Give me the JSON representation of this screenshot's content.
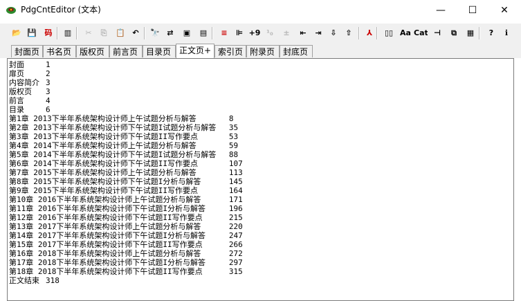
{
  "window": {
    "title": "PdgCntEditor  (文本)",
    "minimize": "—",
    "maximize": "☐",
    "close": "✕"
  },
  "toolbar": {
    "buttons": [
      {
        "icon": "open-folder-icon",
        "glyph": "📂"
      },
      {
        "icon": "save-icon",
        "glyph": "💾"
      },
      {
        "icon": "encoding-icon",
        "glyph": "码",
        "color": "#cc0000"
      },
      {
        "icon": "toggle-view-icon",
        "glyph": "▥"
      },
      {
        "icon": "cut-icon",
        "glyph": "✂",
        "disabled": true
      },
      {
        "icon": "copy-icon",
        "glyph": "⎘",
        "disabled": true
      },
      {
        "icon": "paste-icon",
        "glyph": "📋"
      },
      {
        "icon": "undo-icon",
        "glyph": "↶"
      },
      {
        "icon": "find-icon",
        "glyph": "🔭"
      },
      {
        "icon": "replace-icon",
        "glyph": "⇄"
      },
      {
        "icon": "insert-page-icon",
        "glyph": "▣"
      },
      {
        "icon": "page-properties-icon",
        "glyph": "▤"
      },
      {
        "icon": "align-left-icon",
        "glyph": "≡",
        "color": "#cc0000"
      },
      {
        "icon": "align-indent-icon",
        "glyph": "⊫"
      },
      {
        "icon": "add-number-icon",
        "glyph": "+9"
      },
      {
        "icon": "number-format-icon",
        "glyph": "¹₀",
        "disabled": true
      },
      {
        "icon": "plus-minus-icon",
        "glyph": "±",
        "disabled": true
      },
      {
        "icon": "indent-left-icon",
        "glyph": "⇤"
      },
      {
        "icon": "indent-right-icon",
        "glyph": "⇥"
      },
      {
        "icon": "move-down-icon",
        "glyph": "⇩"
      },
      {
        "icon": "move-up-icon",
        "glyph": "⇧"
      },
      {
        "icon": "pdf-icon",
        "glyph": "⅄",
        "color": "#cc0000"
      },
      {
        "icon": "split-icon",
        "glyph": "▯▯"
      },
      {
        "icon": "font-icon",
        "glyph": "Aa"
      },
      {
        "icon": "catalog-icon",
        "glyph": "Cat"
      },
      {
        "icon": "pin-icon",
        "glyph": "⊣"
      },
      {
        "icon": "window-tile-icon",
        "glyph": "⧉"
      },
      {
        "icon": "screen-icon",
        "glyph": "▦"
      },
      {
        "icon": "help-icon",
        "glyph": "?"
      },
      {
        "icon": "about-icon",
        "glyph": "ℹ"
      }
    ]
  },
  "tabs": [
    {
      "label": "封面页"
    },
    {
      "label": "书名页"
    },
    {
      "label": "版权页"
    },
    {
      "label": "前言页"
    },
    {
      "label": "目录页"
    },
    {
      "label": "正文页+",
      "active": true
    },
    {
      "label": "索引页"
    },
    {
      "label": "附录页"
    },
    {
      "label": "封底页"
    }
  ],
  "editor": {
    "content": "封面\t1\n扉页\t2\n内容简介\t3\n版权页\t3\n前言\t4\n目录\t6\n第1章 2013下半年系统架构设计师上午试题分析与解答\t8\n第2章 2013下半年系统架构设计师下午试题I试题分析与解答\t35\n第3章 2013下半年系统架构设计师下午试题II写作要点\t53\n第4章 2014下半年系统架构设计师上午试题分析与解答\t59\n第5章 2014下半年系统架构设计师下午试题I试题分析与解答\t88\n第6章 2014下半年系统架构设计师下午试题II写作要点\t107\n第7章 2015下半年系统架构设计师上午试题分析与解答\t113\n第8章 2015下半年系统架构设计师下午试题I分析与解答\t145\n第9章 2015下半年系统架构设计师下午试题II写作要点\t164\n第10章 2016下半年系统架构设计师上午试题分析与解答\t171\n第11章 2016下半年系统架构设计师下午试题I分析与解答\t196\n第12章 2016下半年系统架构设计师下午试题II写作要点\t215\n第13章 2017下半年系统架构设计师上午试题分析与解答\t220\n第14章 2017下半年系统架构设计师下午试题I分析与解答\t247\n第15章 2017下半年系统架构设计师下午试题II写作要点\t266\n第16章 2018下半年系统架构设计师上午试题分析与解答\t272\n第17章 2018下半年系统架构设计师下午试题I分析与解答\t297\n第18章 2018下半年系统架构设计师下午试题II写作要点\t315\n正文结束\t318"
  }
}
